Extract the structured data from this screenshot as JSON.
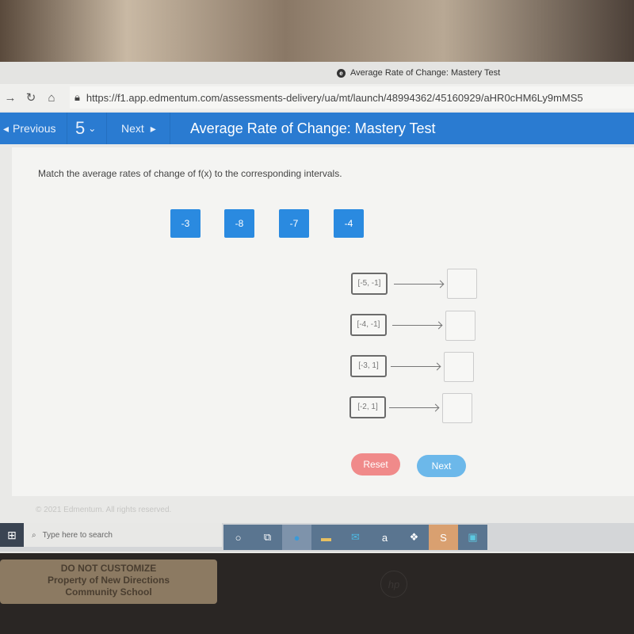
{
  "browser": {
    "tab_title": "Average Rate of Change: Mastery Test",
    "url": "https://f1.app.edmentum.com/assessments-delivery/ua/mt/launch/48994362/45160929/aHR0cHM6Ly9mMS5"
  },
  "nav": {
    "previous_label": "Previous",
    "question_number": "5",
    "next_label": "Next",
    "title": "Average Rate of Change: Mastery Test"
  },
  "question": {
    "prompt": "Match the average rates of change of f(x) to the corresponding intervals.",
    "tiles": [
      "-3",
      "-8",
      "-7",
      "-4"
    ],
    "intervals": [
      "[-5, -1]",
      "[-4, -1]",
      "[-3, 1]",
      "[-2, 1]"
    ]
  },
  "buttons": {
    "reset": "Reset",
    "next": "Next"
  },
  "colors": {
    "nav_blue": "#2a7bd1",
    "tile_blue": "#2a8ae0",
    "reset": "#f08a8a",
    "next": "#6cb8ea"
  },
  "footer": "© 2021 Edmentum. All rights reserved.",
  "taskbar": {
    "search_placeholder": "Type here to search"
  },
  "sticker": {
    "line1": "DO NOT CUSTOMIZE",
    "line2": "Property of New Directions",
    "line3": "Community School"
  },
  "bezel_logo": "hp"
}
